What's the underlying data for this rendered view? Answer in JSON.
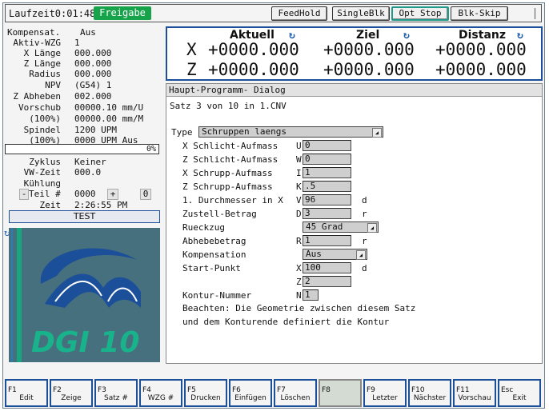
{
  "topbar": {
    "runtime": "Laufzeit0:01:48",
    "status": "Freigabe",
    "buttons": [
      "FeedHold",
      "SingleBlk",
      "Opt Stop",
      "Blk-Skip"
    ]
  },
  "left": {
    "kompensat_label": "Kompensat.",
    "kompensat_value": "Aus",
    "aktiv_wzg_label": "Aktiv-WZG",
    "aktiv_wzg_value": "1",
    "x_laenge_label": "X Länge",
    "x_laenge_value": "000.000",
    "z_laenge_label": "Z Länge",
    "z_laenge_value": "000.000",
    "radius_label": "Radius",
    "radius_value": "000.000",
    "npv_label": "NPV",
    "npv_value": "(G54) 1",
    "z_abheben_label": "Z Abheben",
    "z_abheben_value": "002.000",
    "vorschub_label": "Vorschub",
    "vorschub_value": "00000.10 mm/U",
    "vorschub_pct_label": "(100%)",
    "vorschub_pct_value": "00000.00 mm/M",
    "spindel_label": "Spindel",
    "spindel_value": "1200 UPM",
    "spindel_pct_label": "(100%)",
    "spindel_pct_value": "0000 UPM Aus",
    "progress": "0%",
    "zyklus_label": "Zyklus",
    "zyklus_value": "Keiner",
    "vw_zeit_label": "VW-Zeit",
    "vw_zeit_value": "000.0",
    "kuehlung_label": "Kühlung",
    "teil_minus": "-",
    "teil_label": "Teil #",
    "teil_value": "0000",
    "teil_plus": "+",
    "teil_extra": "0",
    "zeit_label": "Zeit",
    "zeit_value": "2:26:55 PM",
    "test_button": "TEST",
    "logo_text": "DGI 10"
  },
  "positions": {
    "headers": [
      "Aktuell",
      "Ziel",
      "Distanz"
    ],
    "x_axis": "X",
    "z_axis": "Z",
    "x_values": [
      "+0000.000",
      "+0000.000",
      "+0000.000"
    ],
    "z_values": [
      "+0000.000",
      "+0000.000",
      "+0000.000"
    ]
  },
  "program": {
    "header": "Haupt-Programm-  Dialog",
    "satz": "Satz 3 von 10 in 1.CNV",
    "type_label": "Type",
    "type_value": "Schruppen laengs",
    "fields": [
      {
        "label": "X Schlicht-Aufmass",
        "letter": "U",
        "value": "0",
        "unit": ""
      },
      {
        "label": "Z Schlicht-Aufmass",
        "letter": "W",
        "value": "0",
        "unit": ""
      },
      {
        "label": "X Schrupp-Aufmass",
        "letter": "I",
        "value": "1",
        "unit": ""
      },
      {
        "label": "Z Schrupp-Aufmass",
        "letter": "K",
        "value": ".5",
        "unit": ""
      },
      {
        "label": "1. Durchmesser in X",
        "letter": "V",
        "value": "96",
        "unit": "d"
      },
      {
        "label": "Zustell-Betrag",
        "letter": "D",
        "value": "3",
        "unit": "r"
      }
    ],
    "rueckzug_label": "Rueckzug",
    "rueckzug_value": "45 Grad",
    "abhebe_label": "Abhebebetrag",
    "abhebe_letter": "R",
    "abhebe_value": "1",
    "abhebe_unit": "r",
    "komp_label": "Kompensation",
    "komp_value": "Aus",
    "start_label": "Start-Punkt",
    "start_x_letter": "X",
    "start_x_value": "100",
    "start_unit": "d",
    "start_z_letter": "Z",
    "start_z_value": "2",
    "kontur_label": "Kontur-Nummer",
    "kontur_letter": "N",
    "kontur_value": "1",
    "note1": "Beachten: Die Geometrie zwischen diesem Satz",
    "note2": "und dem Konturende definiert die Kontur"
  },
  "fkeys": [
    {
      "key": "F1",
      "label": "Edit"
    },
    {
      "key": "F2",
      "label": "Zeige"
    },
    {
      "key": "F3",
      "label": "Satz #"
    },
    {
      "key": "F4",
      "label": "WZG #"
    },
    {
      "key": "F5",
      "label": "Drucken"
    },
    {
      "key": "F6",
      "label": "Einfügen"
    },
    {
      "key": "F7",
      "label": "Löschen"
    },
    {
      "key": "F8",
      "label": ""
    },
    {
      "key": "F9",
      "label": "Letzter"
    },
    {
      "key": "F10",
      "label": "Nächster"
    },
    {
      "key": "F11",
      "label": "Vorschau"
    },
    {
      "key": "Esc",
      "label": "Exit"
    }
  ],
  "colors": {
    "status_green": "#16a34a",
    "accent_blue": "#1b4f9a",
    "logo_bg": "#47707e",
    "logo_text": "#18b38a"
  }
}
